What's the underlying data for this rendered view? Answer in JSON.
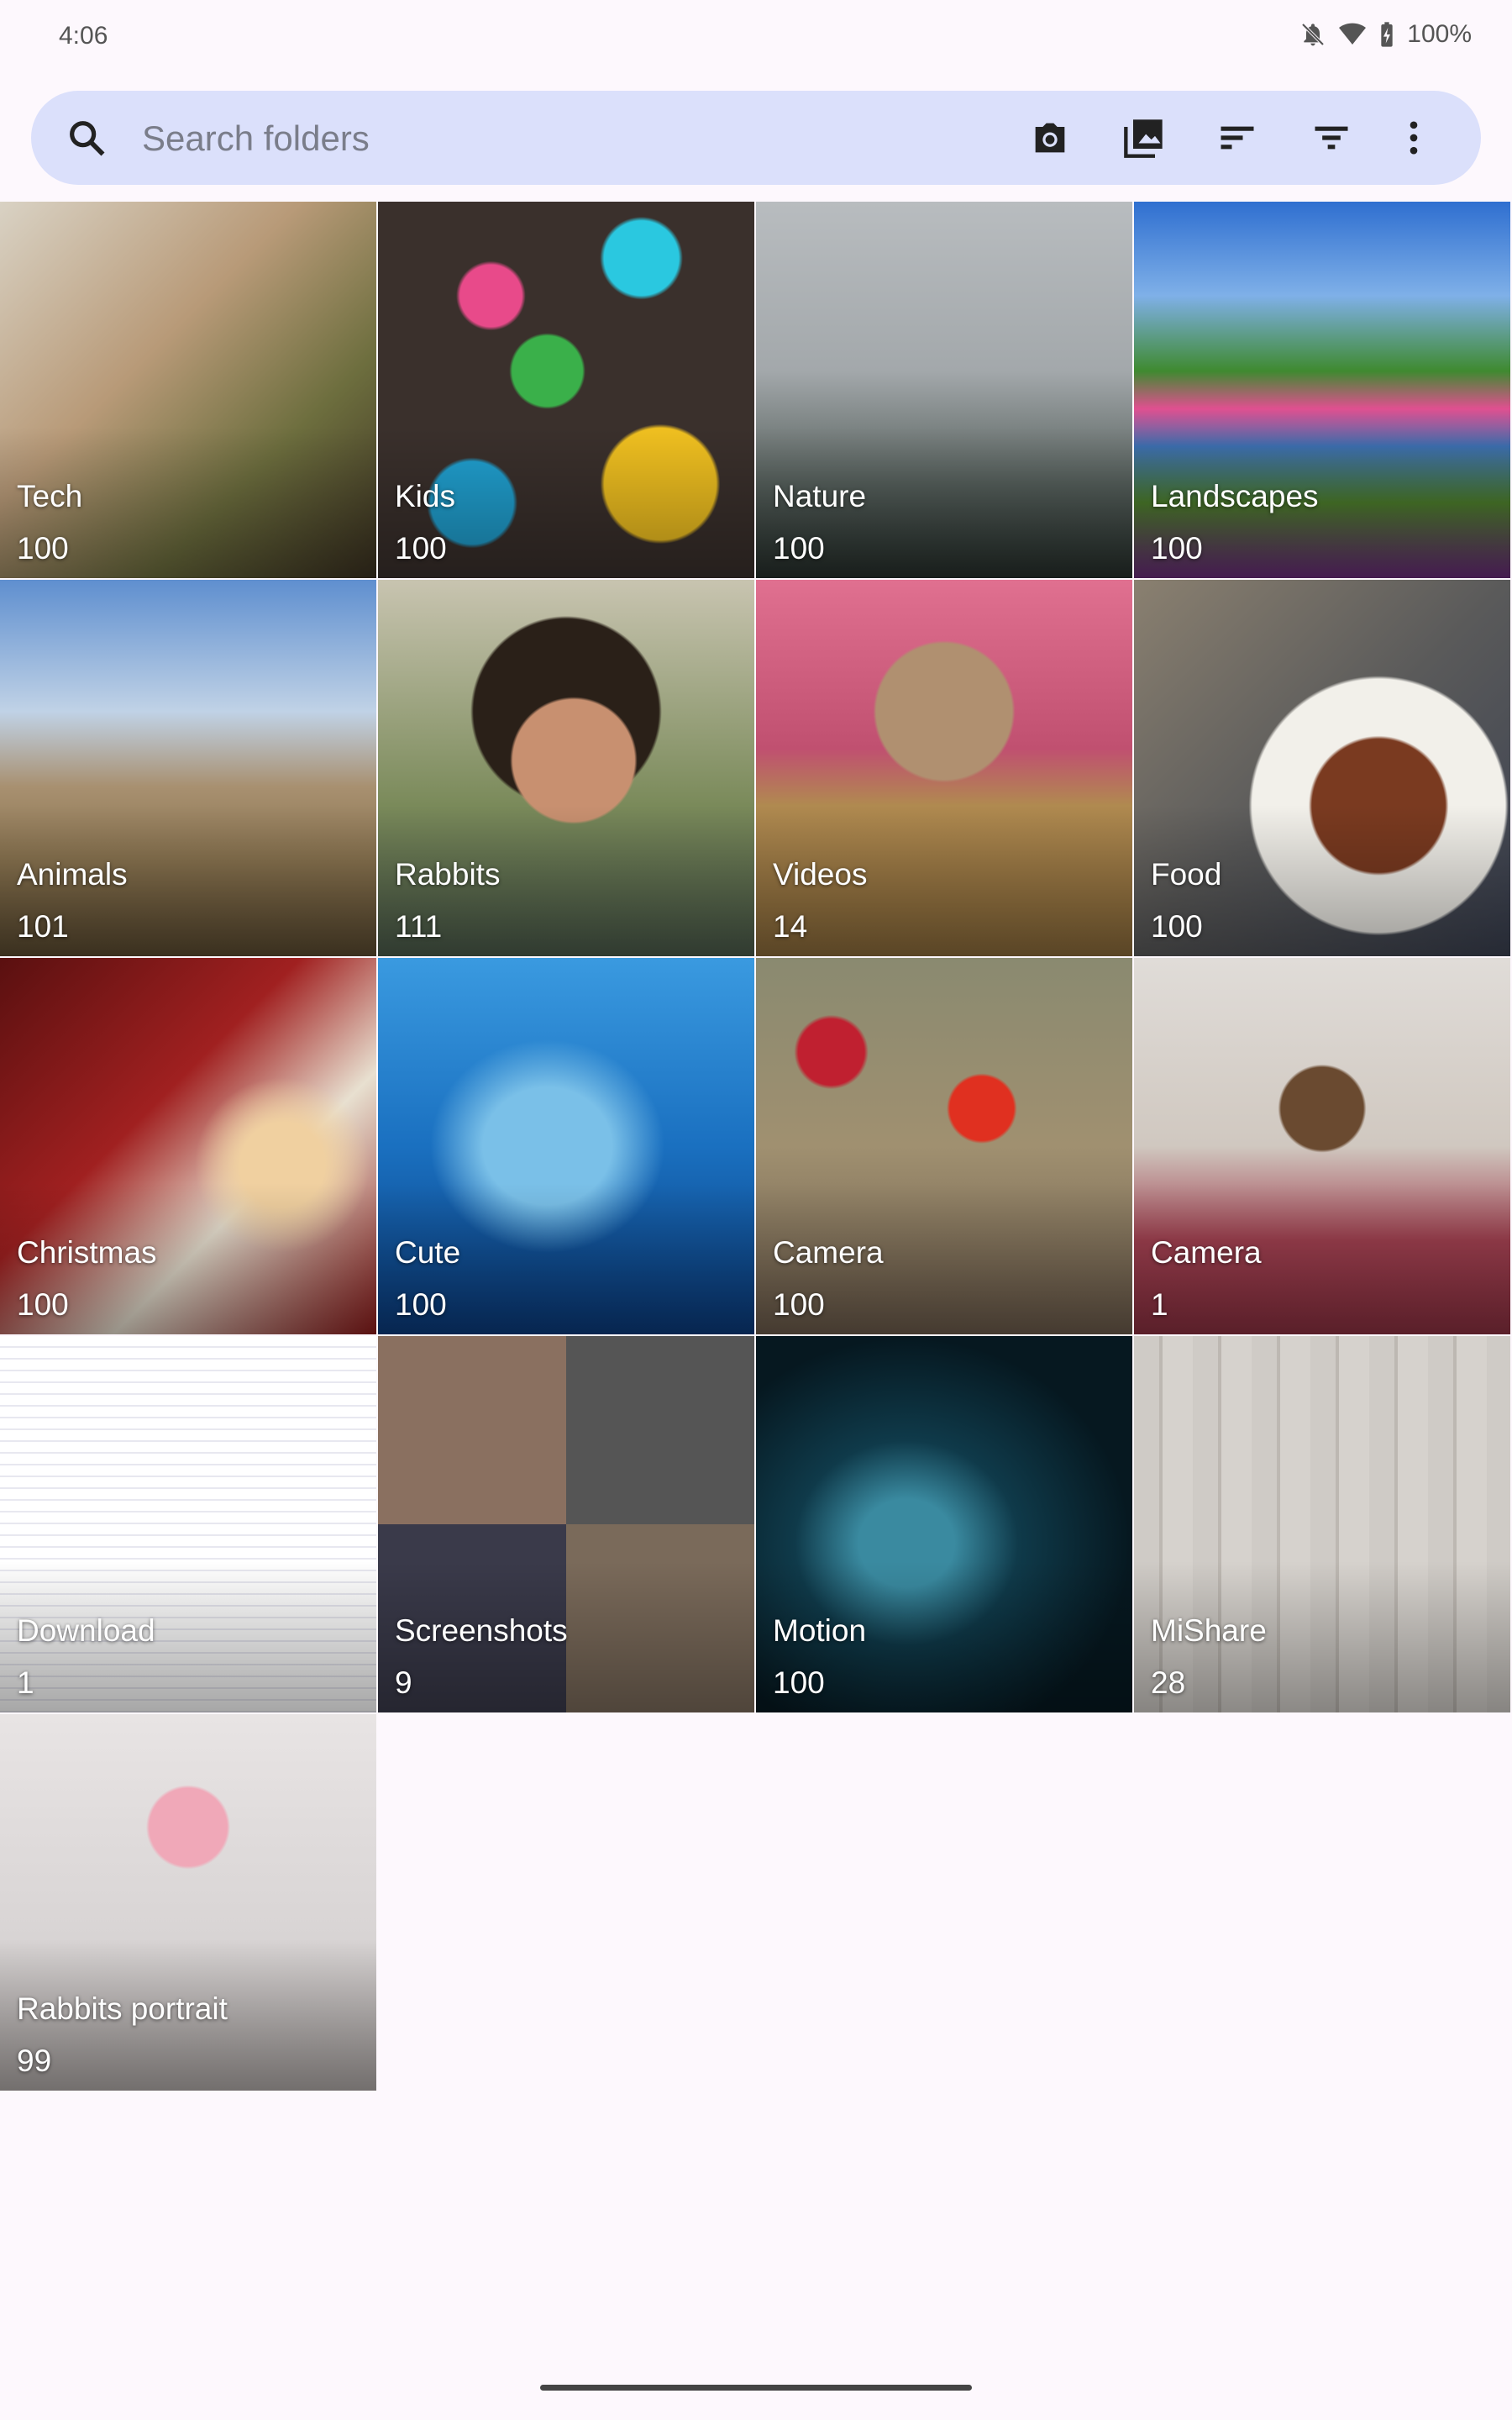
{
  "status_bar": {
    "time": "4:06",
    "battery": "100%",
    "icons": [
      "notifications-off-icon",
      "wifi-icon",
      "battery-charging-icon"
    ]
  },
  "search": {
    "placeholder": "Search folders",
    "value": ""
  },
  "toolbar": {
    "icons": [
      "camera-icon",
      "gallery-icon",
      "sort-icon",
      "filter-icon",
      "more-vert-icon"
    ]
  },
  "folders": [
    {
      "name": "Tech",
      "count": "100",
      "bg": "linear-gradient(135deg,#d9d2c4 0%,#b89a78 40%,#6d6e3e 70%,#3a3020 100%)"
    },
    {
      "name": "Kids",
      "count": "100",
      "bg": "radial-gradient(circle at 30% 25%,#e84a8a 0 8%,transparent 9%),radial-gradient(circle at 70% 15%,#2ac8e0 0 9%,transparent 10%),radial-gradient(circle at 45% 45%,#3ab04a 0 12%,transparent 13%),radial-gradient(circle at 75% 75%,#f0c020 0 14%,transparent 15%),radial-gradient(circle at 25% 80%,#20a0d0 0 10%,transparent 11%),#3a302c"
    },
    {
      "name": "Nature",
      "count": "100",
      "bg": "linear-gradient(180deg,#b8bcbf 0%,#a3a8ab 45%,#56605c 75%,#252e2a 100%)"
    },
    {
      "name": "Landscapes",
      "count": "100",
      "bg": "linear-gradient(180deg,#2f6fd0 0%,#7fb0e8 25%,#3f8a30 45%,#e05090 55%,#3d6fb0 65%,#4a7a2a 80%,#6a2a7a 100%)"
    },
    {
      "name": "Animals",
      "count": "101",
      "bg": "linear-gradient(180deg,#5f8fcf 0%,#c0d2e6 35%,#a89070 55%,#8a7450 75%,#5a4a30 100%)"
    },
    {
      "name": "Rabbits",
      "count": "111",
      "bg": "radial-gradient(circle at 52% 48%,#c89070 0 22%,transparent 23%),radial-gradient(circle at 50% 35%,#2a2018 0 30%,transparent 31%),linear-gradient(180deg,#c8c4b0 0%,#7a8a5a 60%,#4a5a4a 100%)"
    },
    {
      "name": "Videos",
      "count": "14",
      "bg": "radial-gradient(circle at 50% 35%,#b09070 0 22%,transparent 23%),linear-gradient(180deg,#e07090 0%,#c05070 45%,#b08a50 60%,#8a6a3a 100%)"
    },
    {
      "name": "Food",
      "count": "100",
      "bg": "radial-gradient(circle at 65% 60%,#7a3a20 0 20%,#f2f0ea 21% 38%,transparent 39%),linear-gradient(135deg,#8a8070 0%,#5a5a5a 50%,#3a4050 100%)"
    },
    {
      "name": "Christmas",
      "count": "100",
      "bg": "radial-gradient(circle at 75% 55%,#f0d0a0 0 12%,transparent 25%),linear-gradient(135deg,#5a1010 0%,#a02020 40%,#e8e0d0 65%,#8a1a1a 100%)"
    },
    {
      "name": "Cute",
      "count": "100",
      "bg": "radial-gradient(ellipse at 45% 50%,#7ac0e8 0 22%,transparent 40%),linear-gradient(180deg,#3a9ae0 0%,#1a70c0 50%,#0a3a7a 100%)"
    },
    {
      "name": "Camera",
      "count": "100",
      "bg": "radial-gradient(circle at 60% 40%,#e03020 0 10%,transparent 11%),radial-gradient(circle at 20% 25%,#c02030 0 8%,transparent 9%),linear-gradient(180deg,#8a8a70 0%,#a09070 50%,#6a5a4a 100%)"
    },
    {
      "name": "Camera",
      "count": "1",
      "bg": "radial-gradient(circle at 50% 40%,#6a4a30 0 14%,transparent 15%),linear-gradient(180deg,#e0dcd8 0%,#d0c8c0 50%,#a04050 75%,#8a3040 100%)"
    },
    {
      "name": "Download",
      "count": "1",
      "bg": "repeating-linear-gradient(180deg,#fff 0 12px,#e8e8f0 12px 14px),#fff"
    },
    {
      "name": "Screenshots",
      "count": "9",
      "bg": "conic-gradient(from 0deg,#555 0 25%,#7a6a5a 0 50%,#3a3a4a 0 75%,#8a7060 0)"
    },
    {
      "name": "Motion",
      "count": "100",
      "bg": "radial-gradient(ellipse at 40% 55%,#3a8aa0 0 15%,#0f3a4a 35%,#061820 70%)"
    },
    {
      "name": "MiShare",
      "count": "28",
      "bg": "repeating-linear-gradient(90deg,#cfcbc6 0 30px,#bdb8b2 30px 34px,#d6d2cd 34px 70px)"
    },
    {
      "name": "Rabbits portrait",
      "count": "99",
      "bg": "radial-gradient(circle at 50% 30%,#f0a8b8 0 12%,transparent 13%),linear-gradient(180deg,#e8e4e4 0%,#d8d4d4 60%,#b0aaa8 100%)"
    }
  ]
}
